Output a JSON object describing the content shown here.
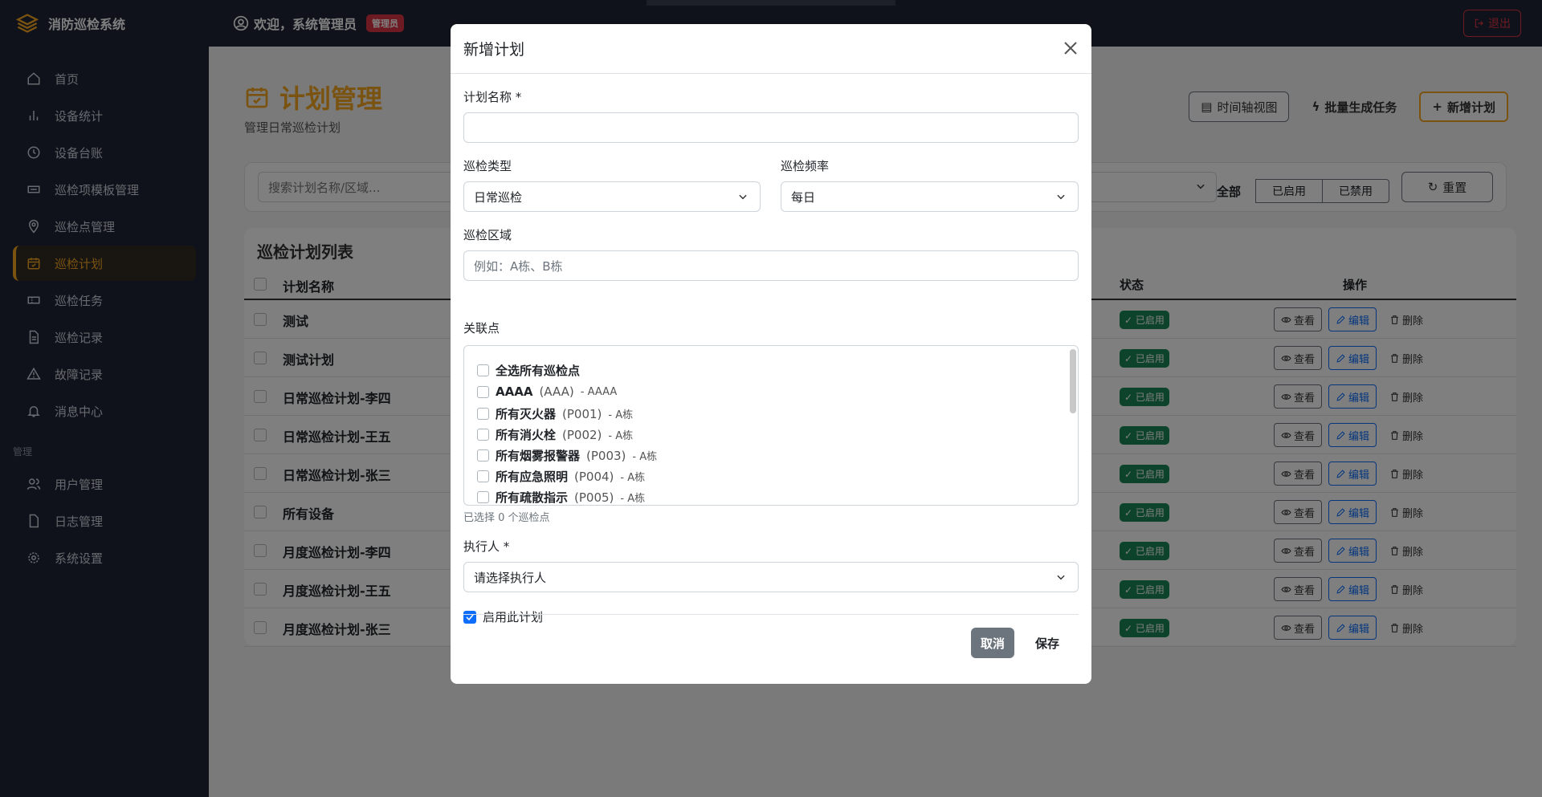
{
  "app": {
    "title": "消防巡检系统"
  },
  "topbar": {
    "welcome": "欢迎，系统管理员",
    "role_badge": "管理员",
    "logout": "退出"
  },
  "sidebar": {
    "items": [
      {
        "label": "首页",
        "icon": "home-icon"
      },
      {
        "label": "设备统计",
        "icon": "bar-chart-icon"
      },
      {
        "label": "设备台账",
        "icon": "clock-icon"
      },
      {
        "label": "巡检项模板管理",
        "icon": "template-icon"
      },
      {
        "label": "巡检点管理",
        "icon": "location-pin-icon"
      },
      {
        "label": "巡检计划",
        "icon": "calendar-check-icon",
        "active": true
      },
      {
        "label": "巡检任务",
        "icon": "ticket-icon"
      },
      {
        "label": "巡检记录",
        "icon": "file-text-icon"
      },
      {
        "label": "故障记录",
        "icon": "warning-icon"
      },
      {
        "label": "消息中心",
        "icon": "bell-icon"
      }
    ],
    "section_label": "管理",
    "admin_items": [
      {
        "label": "用户管理",
        "icon": "users-icon"
      },
      {
        "label": "日志管理",
        "icon": "file-icon"
      },
      {
        "label": "系统设置",
        "icon": "gear-icon"
      }
    ]
  },
  "page": {
    "title": "计划管理",
    "subtitle": "管理日常巡检计划"
  },
  "actions": {
    "timeline": "时间轴视图",
    "batch": "批量生成任务",
    "add": "新增计划"
  },
  "filters": {
    "search_placeholder": "搜索计划名称/区域...",
    "all": "全部",
    "enabled": "已启用",
    "disabled": "已禁用",
    "reset": "重置"
  },
  "table": {
    "title": "巡检计划列表",
    "columns": {
      "name": "计划名称",
      "status": "状态",
      "ops": "操作"
    },
    "rows": [
      {
        "name": "测试",
        "status": "已启用"
      },
      {
        "name": "测试计划",
        "status": "已启用"
      },
      {
        "name": "日常巡检计划-李四",
        "status": "已启用"
      },
      {
        "name": "日常巡检计划-王五",
        "status": "已启用"
      },
      {
        "name": "日常巡检计划-张三",
        "status": "已启用"
      },
      {
        "name": "所有设备",
        "status": "已启用"
      },
      {
        "name": "月度巡检计划-李四",
        "status": "已启用"
      },
      {
        "name": "月度巡检计划-王五",
        "status": "已启用"
      },
      {
        "name": "月度巡检计划-张三",
        "status": "已启用"
      }
    ],
    "op_labels": {
      "view": "查看",
      "edit": "编辑",
      "delete": "删除"
    }
  },
  "modal": {
    "title": "新增计划",
    "plan_name_label": "计划名称 *",
    "plan_name_value": "",
    "type_label": "巡检类型",
    "type_value": "日常巡检",
    "freq_label": "巡检频率",
    "freq_value": "每日",
    "area_label": "巡检区域",
    "area_placeholder": "例如：A栋、B栋",
    "points_label": "关联点",
    "select_all": "全选所有巡检点",
    "points": [
      {
        "name": "AAAA",
        "code": "(AAA)",
        "area": "- AAAA"
      },
      {
        "name": "所有灭火器",
        "code": "(P001)",
        "area": "- A栋"
      },
      {
        "name": "所有消火栓",
        "code": "(P002)",
        "area": "- A栋"
      },
      {
        "name": "所有烟雾报警器",
        "code": "(P003)",
        "area": "- A栋"
      },
      {
        "name": "所有应急照明",
        "code": "(P004)",
        "area": "- A栋"
      },
      {
        "name": "所有疏散指示",
        "code": "(P005)",
        "area": "- A栋"
      }
    ],
    "selected_hint": "已选择 0 个巡检点",
    "executor_label": "执行人 *",
    "executor_value": "请选择执行人",
    "enable_label": "启用此计划",
    "enable_checked": true,
    "cancel": "取消",
    "save": "保存"
  },
  "colors": {
    "accent": "#f5a623",
    "sidebar_bg": "#1e2535",
    "success": "#198754",
    "danger": "#dc3545",
    "primary": "#0d6efd"
  }
}
